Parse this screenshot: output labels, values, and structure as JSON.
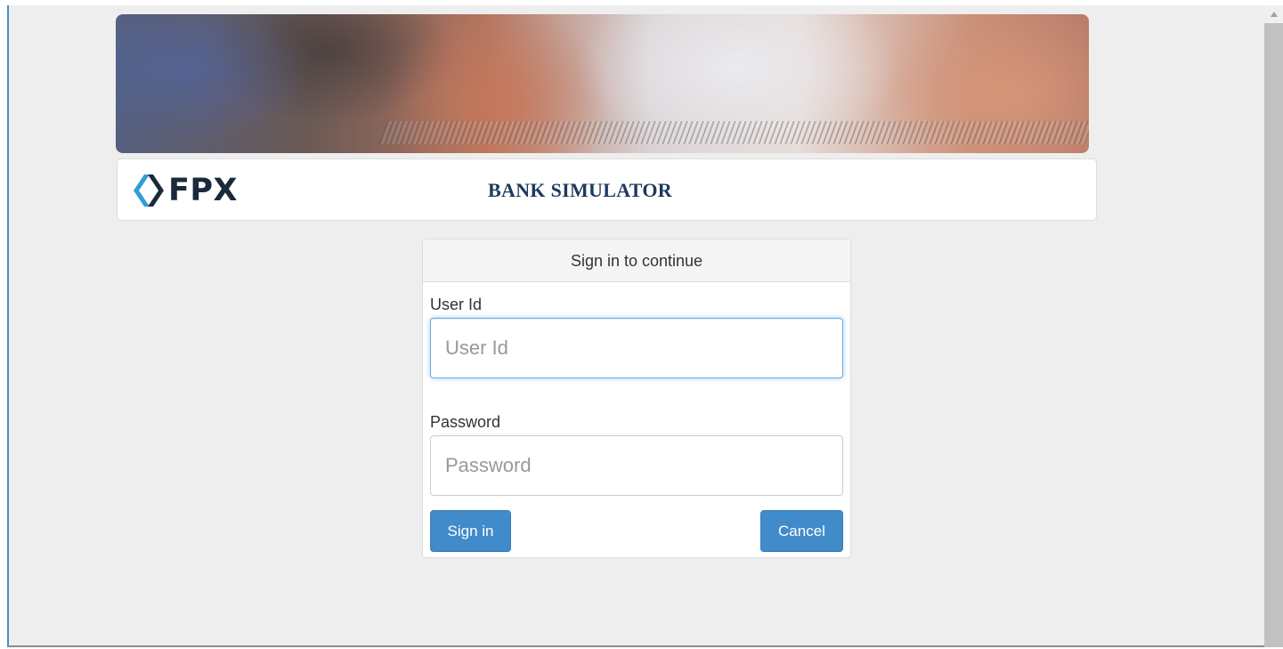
{
  "header": {
    "logo_text": "FPX",
    "title": "BANK SIMULATOR"
  },
  "login": {
    "heading": "Sign in to continue",
    "user_id_label": "User Id",
    "user_id_placeholder": "User Id",
    "user_id_value": "",
    "password_label": "Password",
    "password_placeholder": "Password",
    "password_value": "",
    "signin_label": "Sign in",
    "cancel_label": "Cancel"
  },
  "colors": {
    "primary_button": "#428bca",
    "title_text": "#1d3a5c",
    "focus_border": "#66afe9",
    "page_background": "#eeeeee"
  },
  "icons": {
    "logo": "fpx-chevrons-icon",
    "scroll_up": "triangle-up-icon"
  }
}
